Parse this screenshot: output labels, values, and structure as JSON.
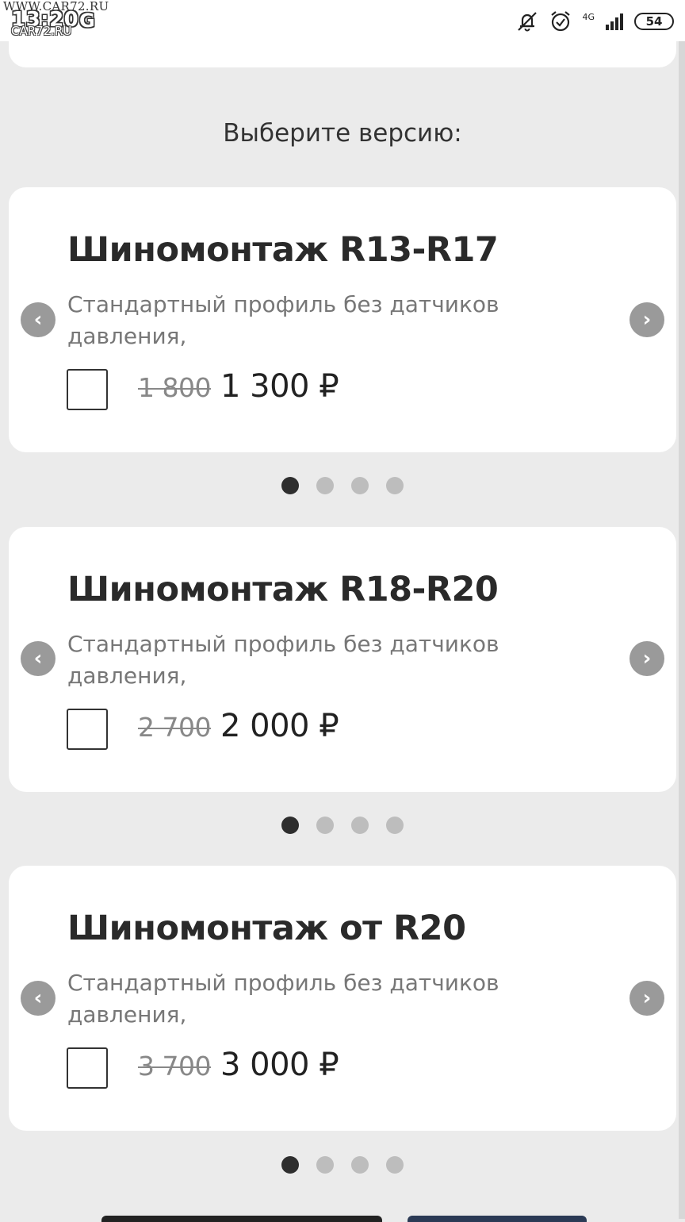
{
  "status_bar": {
    "watermark_top": "WWW.CAR72.RU",
    "watermark_bottom": "CAR72.RU",
    "time": "13:20",
    "logo_letter": "G",
    "network": "4G",
    "battery": "54",
    "icons": [
      "bell-off-icon",
      "alarm-clock-icon",
      "signal-icon",
      "battery-icon"
    ]
  },
  "section_title": "Выберите версию:",
  "cards": [
    {
      "title": "Шиномонтаж R13-R17",
      "description": "Стандартный профиль без датчиков давления,",
      "old_price": "1 800",
      "new_price": "1 300 ₽",
      "active_dot": 1,
      "dot_count": 4
    },
    {
      "title": "Шиномонтаж R18-R20",
      "description": "Стандартный профиль без датчиков давления,",
      "old_price": "2 700",
      "new_price": "2 000 ₽",
      "active_dot": 1,
      "dot_count": 4
    },
    {
      "title": "Шиномонтаж от R20",
      "description": "Стандартный профиль без датчиков давления,",
      "old_price": "3 700",
      "new_price": "3 000 ₽",
      "active_dot": 1,
      "dot_count": 4
    }
  ],
  "colors": {
    "background": "#ebebeb",
    "card": "#ffffff",
    "arrow": "#9a9a9a",
    "dot_active": "#2e2e2e",
    "dot_inactive": "#bdbdbd"
  }
}
